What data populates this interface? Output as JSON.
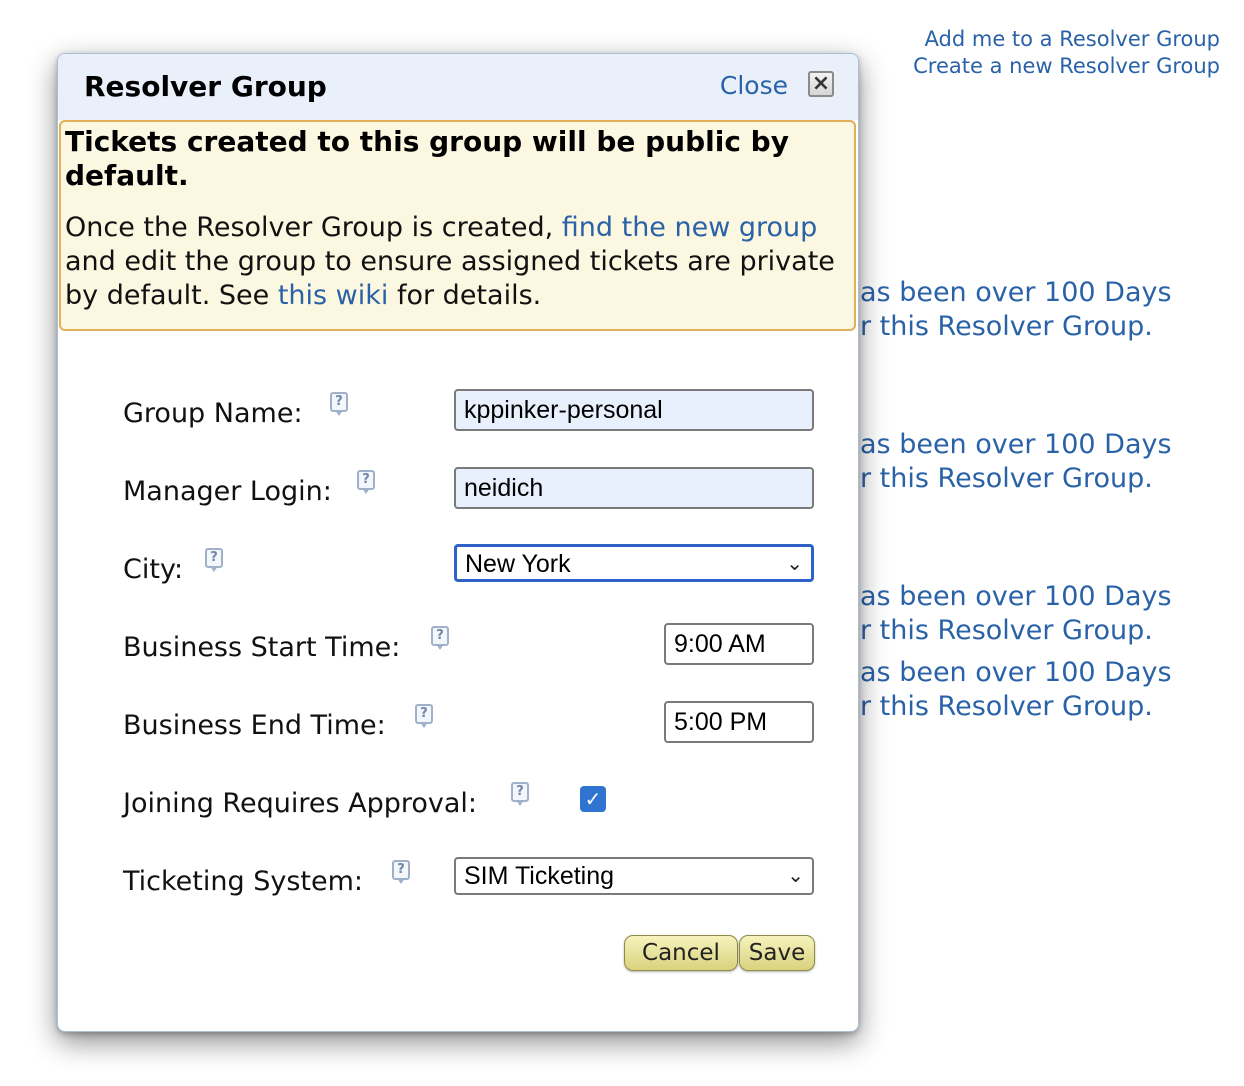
{
  "top_links": {
    "add_me": "Add me to a Resolver Group",
    "create_new": "Create a new Resolver Group"
  },
  "background_messages": [
    {
      "line1": "as been over 100 Days",
      "line2": "r this Resolver Group."
    },
    {
      "line1": "as been over 100 Days",
      "line2": "r this Resolver Group."
    },
    {
      "line1": "as been over 100 Days",
      "line2": "r this Resolver Group."
    },
    {
      "line1": "as been over 100 Days",
      "line2": "r this Resolver Group."
    }
  ],
  "modal": {
    "title": "Resolver Group",
    "close_label": "Close",
    "close_icon": "close-icon",
    "notice": {
      "title": "Tickets created to this group will be public by default.",
      "body_part1": "Once the Resolver Group is created, ",
      "link1": "find the new group",
      "body_part2": " and edit the group to ensure assigned tickets are private by default. See ",
      "link2": "this wiki",
      "body_part3": " for details."
    },
    "form": {
      "group_name": {
        "label": "Group Name:",
        "value": "kppinker-personal"
      },
      "manager_login": {
        "label": "Manager Login:",
        "value": "neidich"
      },
      "city": {
        "label": "City:",
        "value": "New York"
      },
      "business_start": {
        "label": "Business Start Time:",
        "value": "9:00 AM"
      },
      "business_end": {
        "label": "Business End Time:",
        "value": "5:00 PM"
      },
      "joining_approval": {
        "label": "Joining Requires Approval:",
        "checked": true
      },
      "ticketing_system": {
        "label": "Ticketing System:",
        "value": "SIM Ticketing"
      }
    },
    "buttons": {
      "cancel": "Cancel",
      "save": "Save"
    }
  },
  "colors": {
    "link": "#2a62a8",
    "notice_bg": "#fcf7e1",
    "notice_border": "#e3b05a",
    "header_bg": "#e9f0f9",
    "button_bg": "#e9e49f"
  }
}
